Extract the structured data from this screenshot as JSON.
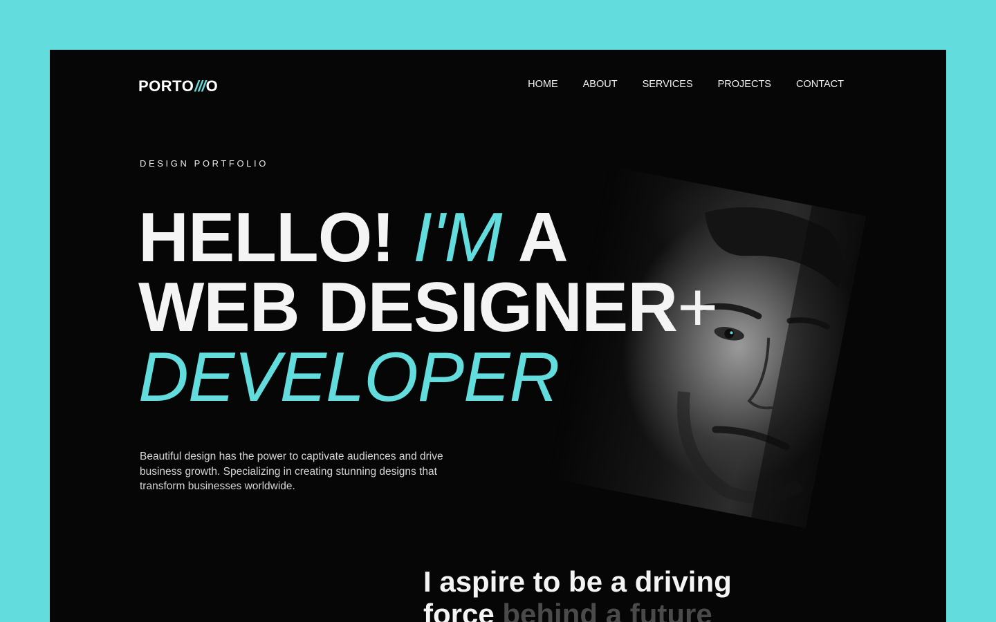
{
  "brand": {
    "prefix": "PORTO",
    "slashes": "///",
    "suffix": "O"
  },
  "nav": {
    "items": [
      {
        "label": "HOME"
      },
      {
        "label": "ABOUT"
      },
      {
        "label": "SERVICES"
      },
      {
        "label": "PROJECTS"
      },
      {
        "label": "CONTACT"
      }
    ]
  },
  "hero": {
    "eyebrow": "DESIGN PORTFOLIO",
    "line1_a": "HELLO! ",
    "line1_accent": "I'M",
    "line1_b": " A",
    "line2_main": "WEB DESIGNER",
    "line2_plus": "+",
    "line3_accent": "DEVELOPER",
    "description": "Beautiful design has the power to captivate audiences and drive business growth. Specializing in creating stunning designs that transform businesses worldwide.",
    "photo_alt": "portrait-photo"
  },
  "aspire": {
    "line1": "I aspire to be a driving",
    "line2_bright": "force ",
    "line2_dim": "behind a future"
  },
  "colors": {
    "accent": "#63dcde",
    "background": "#060606",
    "outer": "#63dcde"
  }
}
